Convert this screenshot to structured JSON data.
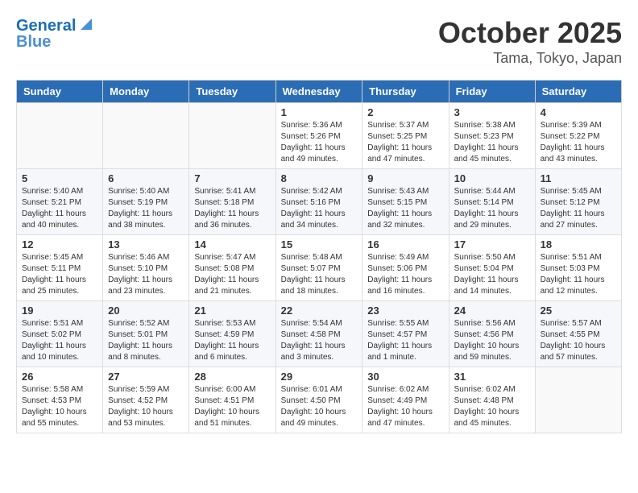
{
  "header": {
    "logo_line1": "General",
    "logo_line2": "Blue",
    "month": "October 2025",
    "location": "Tama, Tokyo, Japan"
  },
  "weekdays": [
    "Sunday",
    "Monday",
    "Tuesday",
    "Wednesday",
    "Thursday",
    "Friday",
    "Saturday"
  ],
  "weeks": [
    [
      {
        "day": "",
        "info": ""
      },
      {
        "day": "",
        "info": ""
      },
      {
        "day": "",
        "info": ""
      },
      {
        "day": "1",
        "info": "Sunrise: 5:36 AM\nSunset: 5:26 PM\nDaylight: 11 hours and 49 minutes."
      },
      {
        "day": "2",
        "info": "Sunrise: 5:37 AM\nSunset: 5:25 PM\nDaylight: 11 hours and 47 minutes."
      },
      {
        "day": "3",
        "info": "Sunrise: 5:38 AM\nSunset: 5:23 PM\nDaylight: 11 hours and 45 minutes."
      },
      {
        "day": "4",
        "info": "Sunrise: 5:39 AM\nSunset: 5:22 PM\nDaylight: 11 hours and 43 minutes."
      }
    ],
    [
      {
        "day": "5",
        "info": "Sunrise: 5:40 AM\nSunset: 5:21 PM\nDaylight: 11 hours and 40 minutes."
      },
      {
        "day": "6",
        "info": "Sunrise: 5:40 AM\nSunset: 5:19 PM\nDaylight: 11 hours and 38 minutes."
      },
      {
        "day": "7",
        "info": "Sunrise: 5:41 AM\nSunset: 5:18 PM\nDaylight: 11 hours and 36 minutes."
      },
      {
        "day": "8",
        "info": "Sunrise: 5:42 AM\nSunset: 5:16 PM\nDaylight: 11 hours and 34 minutes."
      },
      {
        "day": "9",
        "info": "Sunrise: 5:43 AM\nSunset: 5:15 PM\nDaylight: 11 hours and 32 minutes."
      },
      {
        "day": "10",
        "info": "Sunrise: 5:44 AM\nSunset: 5:14 PM\nDaylight: 11 hours and 29 minutes."
      },
      {
        "day": "11",
        "info": "Sunrise: 5:45 AM\nSunset: 5:12 PM\nDaylight: 11 hours and 27 minutes."
      }
    ],
    [
      {
        "day": "12",
        "info": "Sunrise: 5:45 AM\nSunset: 5:11 PM\nDaylight: 11 hours and 25 minutes."
      },
      {
        "day": "13",
        "info": "Sunrise: 5:46 AM\nSunset: 5:10 PM\nDaylight: 11 hours and 23 minutes."
      },
      {
        "day": "14",
        "info": "Sunrise: 5:47 AM\nSunset: 5:08 PM\nDaylight: 11 hours and 21 minutes."
      },
      {
        "day": "15",
        "info": "Sunrise: 5:48 AM\nSunset: 5:07 PM\nDaylight: 11 hours and 18 minutes."
      },
      {
        "day": "16",
        "info": "Sunrise: 5:49 AM\nSunset: 5:06 PM\nDaylight: 11 hours and 16 minutes."
      },
      {
        "day": "17",
        "info": "Sunrise: 5:50 AM\nSunset: 5:04 PM\nDaylight: 11 hours and 14 minutes."
      },
      {
        "day": "18",
        "info": "Sunrise: 5:51 AM\nSunset: 5:03 PM\nDaylight: 11 hours and 12 minutes."
      }
    ],
    [
      {
        "day": "19",
        "info": "Sunrise: 5:51 AM\nSunset: 5:02 PM\nDaylight: 11 hours and 10 minutes."
      },
      {
        "day": "20",
        "info": "Sunrise: 5:52 AM\nSunset: 5:01 PM\nDaylight: 11 hours and 8 minutes."
      },
      {
        "day": "21",
        "info": "Sunrise: 5:53 AM\nSunset: 4:59 PM\nDaylight: 11 hours and 6 minutes."
      },
      {
        "day": "22",
        "info": "Sunrise: 5:54 AM\nSunset: 4:58 PM\nDaylight: 11 hours and 3 minutes."
      },
      {
        "day": "23",
        "info": "Sunrise: 5:55 AM\nSunset: 4:57 PM\nDaylight: 11 hours and 1 minute."
      },
      {
        "day": "24",
        "info": "Sunrise: 5:56 AM\nSunset: 4:56 PM\nDaylight: 10 hours and 59 minutes."
      },
      {
        "day": "25",
        "info": "Sunrise: 5:57 AM\nSunset: 4:55 PM\nDaylight: 10 hours and 57 minutes."
      }
    ],
    [
      {
        "day": "26",
        "info": "Sunrise: 5:58 AM\nSunset: 4:53 PM\nDaylight: 10 hours and 55 minutes."
      },
      {
        "day": "27",
        "info": "Sunrise: 5:59 AM\nSunset: 4:52 PM\nDaylight: 10 hours and 53 minutes."
      },
      {
        "day": "28",
        "info": "Sunrise: 6:00 AM\nSunset: 4:51 PM\nDaylight: 10 hours and 51 minutes."
      },
      {
        "day": "29",
        "info": "Sunrise: 6:01 AM\nSunset: 4:50 PM\nDaylight: 10 hours and 49 minutes."
      },
      {
        "day": "30",
        "info": "Sunrise: 6:02 AM\nSunset: 4:49 PM\nDaylight: 10 hours and 47 minutes."
      },
      {
        "day": "31",
        "info": "Sunrise: 6:02 AM\nSunset: 4:48 PM\nDaylight: 10 hours and 45 minutes."
      },
      {
        "day": "",
        "info": ""
      }
    ]
  ]
}
